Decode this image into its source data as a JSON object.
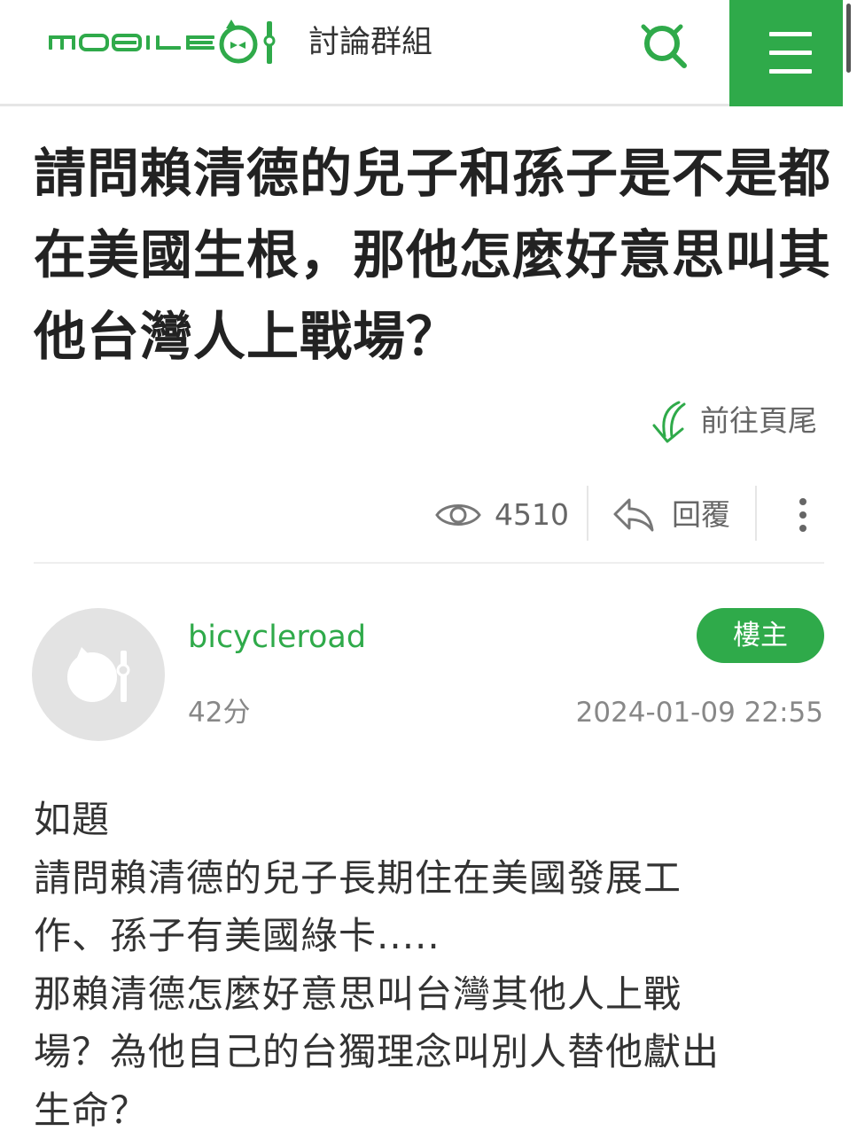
{
  "colors": {
    "brand_green": "#2faa4a",
    "text_dark": "#222222",
    "text_muted": "#888888"
  },
  "header": {
    "logo_text": "MOBILE01",
    "section_title": "討論群組",
    "search_icon": "search-icon",
    "menu_icon": "hamburger-menu-icon"
  },
  "thread": {
    "title": "請問賴清德的兒子和孫子是不是都在美國生根，那他怎麼好意思叫其他台灣人上戰場？",
    "goto_bottom_label": "前往頁尾",
    "views": "4510",
    "reply_label": "回覆"
  },
  "post": {
    "author": "bicycleroad",
    "author_score": "42分",
    "badge": "樓主",
    "date": "2024-01-09 22:55",
    "body_lines": [
      "如題",
      "請問賴清德的兒子長期住在美國發展工",
      "作、孫子有美國綠卡.....",
      "那賴清德怎麼好意思叫台灣其他人上戰",
      "場？為他自己的台獨理念叫別人替他獻出",
      "生命？"
    ]
  }
}
